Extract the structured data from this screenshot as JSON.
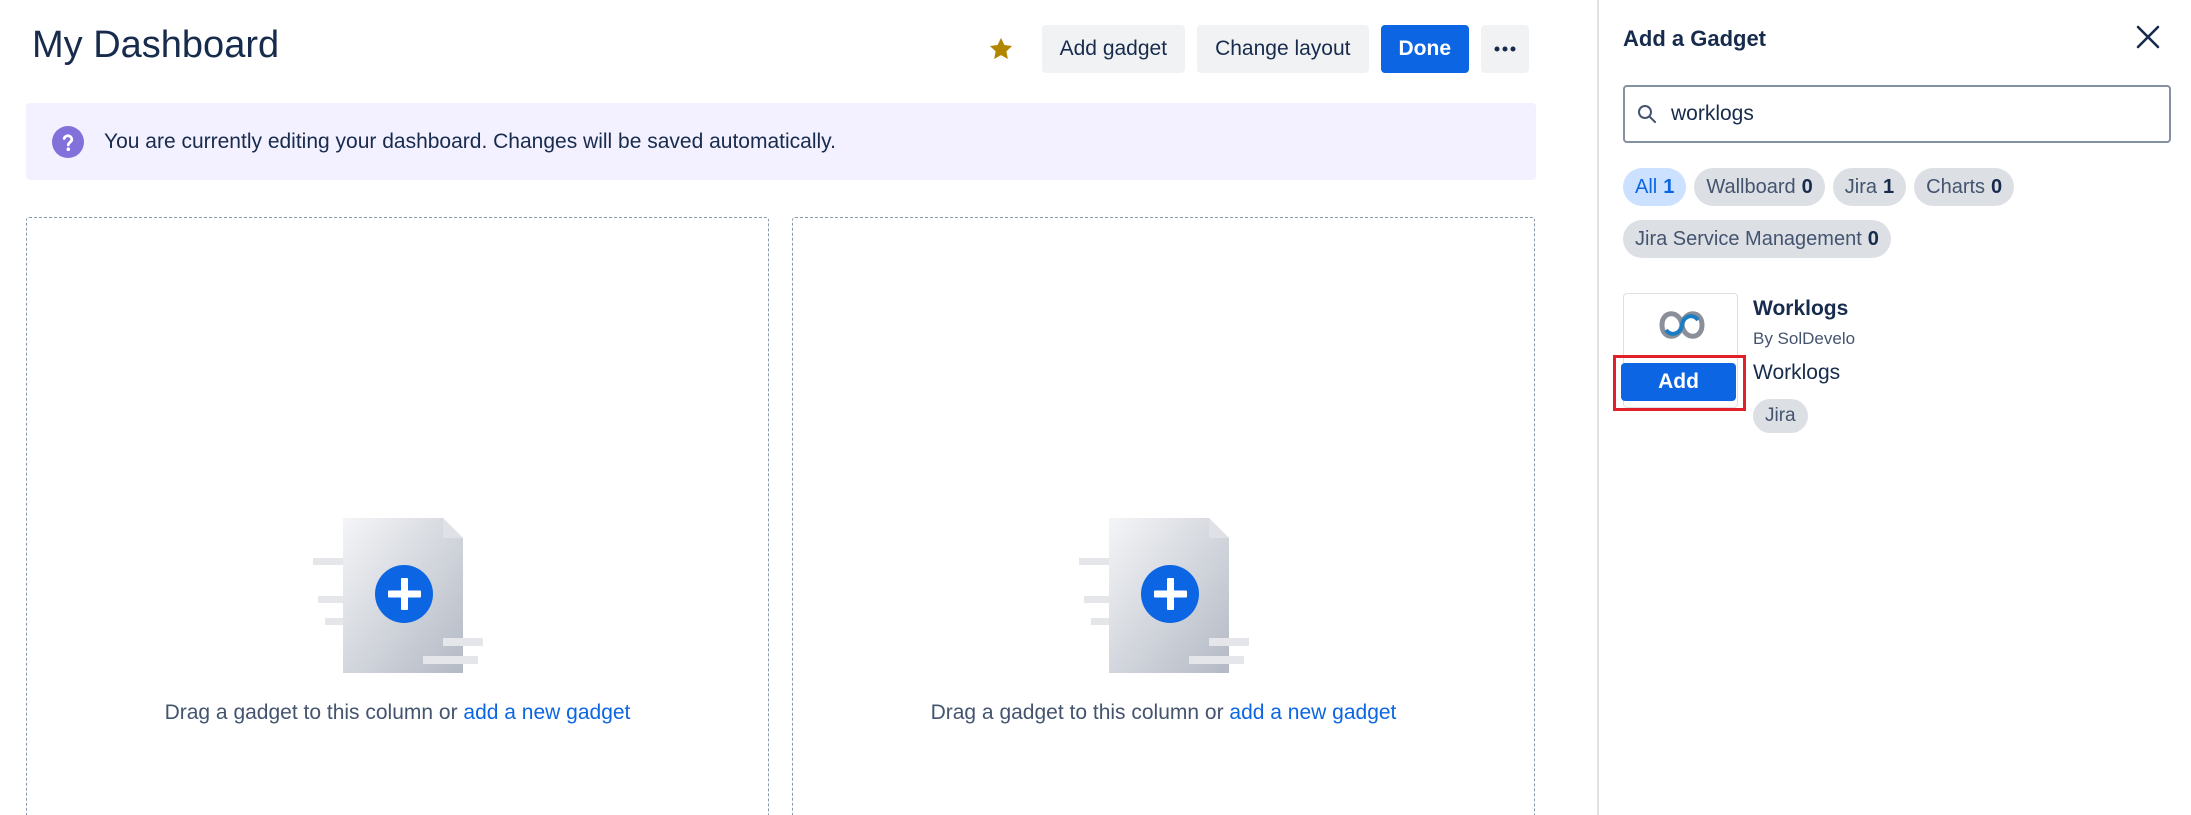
{
  "dashboard": {
    "title": "My Dashboard",
    "actions": {
      "add_gadget": "Add gadget",
      "change_layout": "Change layout",
      "done": "Done",
      "more": "···"
    },
    "banner": "You are currently editing your dashboard. Changes will be saved automatically.",
    "columns": [
      {
        "text": "Drag a gadget to this column or ",
        "link": "add a new gadget"
      },
      {
        "text": "Drag a gadget to this column or ",
        "link": "add a new gadget"
      }
    ]
  },
  "panel": {
    "title": "Add a Gadget",
    "search": {
      "value": "worklogs",
      "placeholder": ""
    },
    "filters": [
      {
        "label": "All",
        "count": "1",
        "active": true
      },
      {
        "label": "Wallboard",
        "count": "0"
      },
      {
        "label": "Jira",
        "count": "1"
      },
      {
        "label": "Charts",
        "count": "0"
      },
      {
        "label": "Jira Service Management",
        "count": "0"
      }
    ],
    "results": [
      {
        "name": "Worklogs",
        "by": "By SolDevelo",
        "description": "Worklogs",
        "tag": "Jira",
        "add_label": "Add"
      }
    ]
  },
  "colors": {
    "primary": "#0c66e4",
    "star": "#b38600",
    "banner_bg": "#f3f0ff",
    "highlight": "#e2202a"
  },
  "icons": {
    "star": "star-icon",
    "info": "question-circle-icon",
    "close": "close-icon",
    "search": "search-icon"
  }
}
